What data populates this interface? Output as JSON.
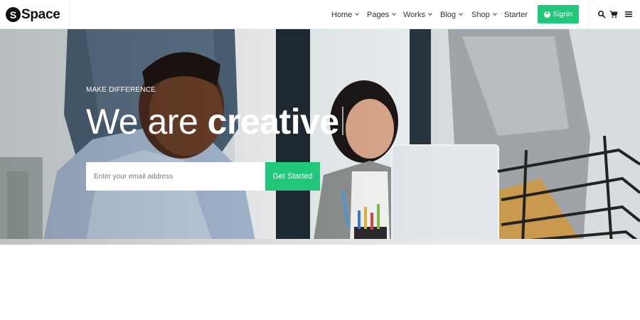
{
  "brand": {
    "letter": "S",
    "name": "Space"
  },
  "nav": {
    "home": "Home",
    "pages": "Pages",
    "works": "Works",
    "blog": "Blog",
    "shop": "Shop",
    "starter": "Starter",
    "signin": "Signin"
  },
  "tools": [
    "search-icon",
    "cart-icon",
    "menu-icon"
  ],
  "hero": {
    "eyebrow": "MAKE DIFFERENCE",
    "headline_light": "We are ",
    "headline_bold": "creative",
    "email_placeholder": "Enter your email address",
    "cta": "Get Started"
  },
  "colors": {
    "accent": "#21c87a",
    "text": "#333333"
  }
}
